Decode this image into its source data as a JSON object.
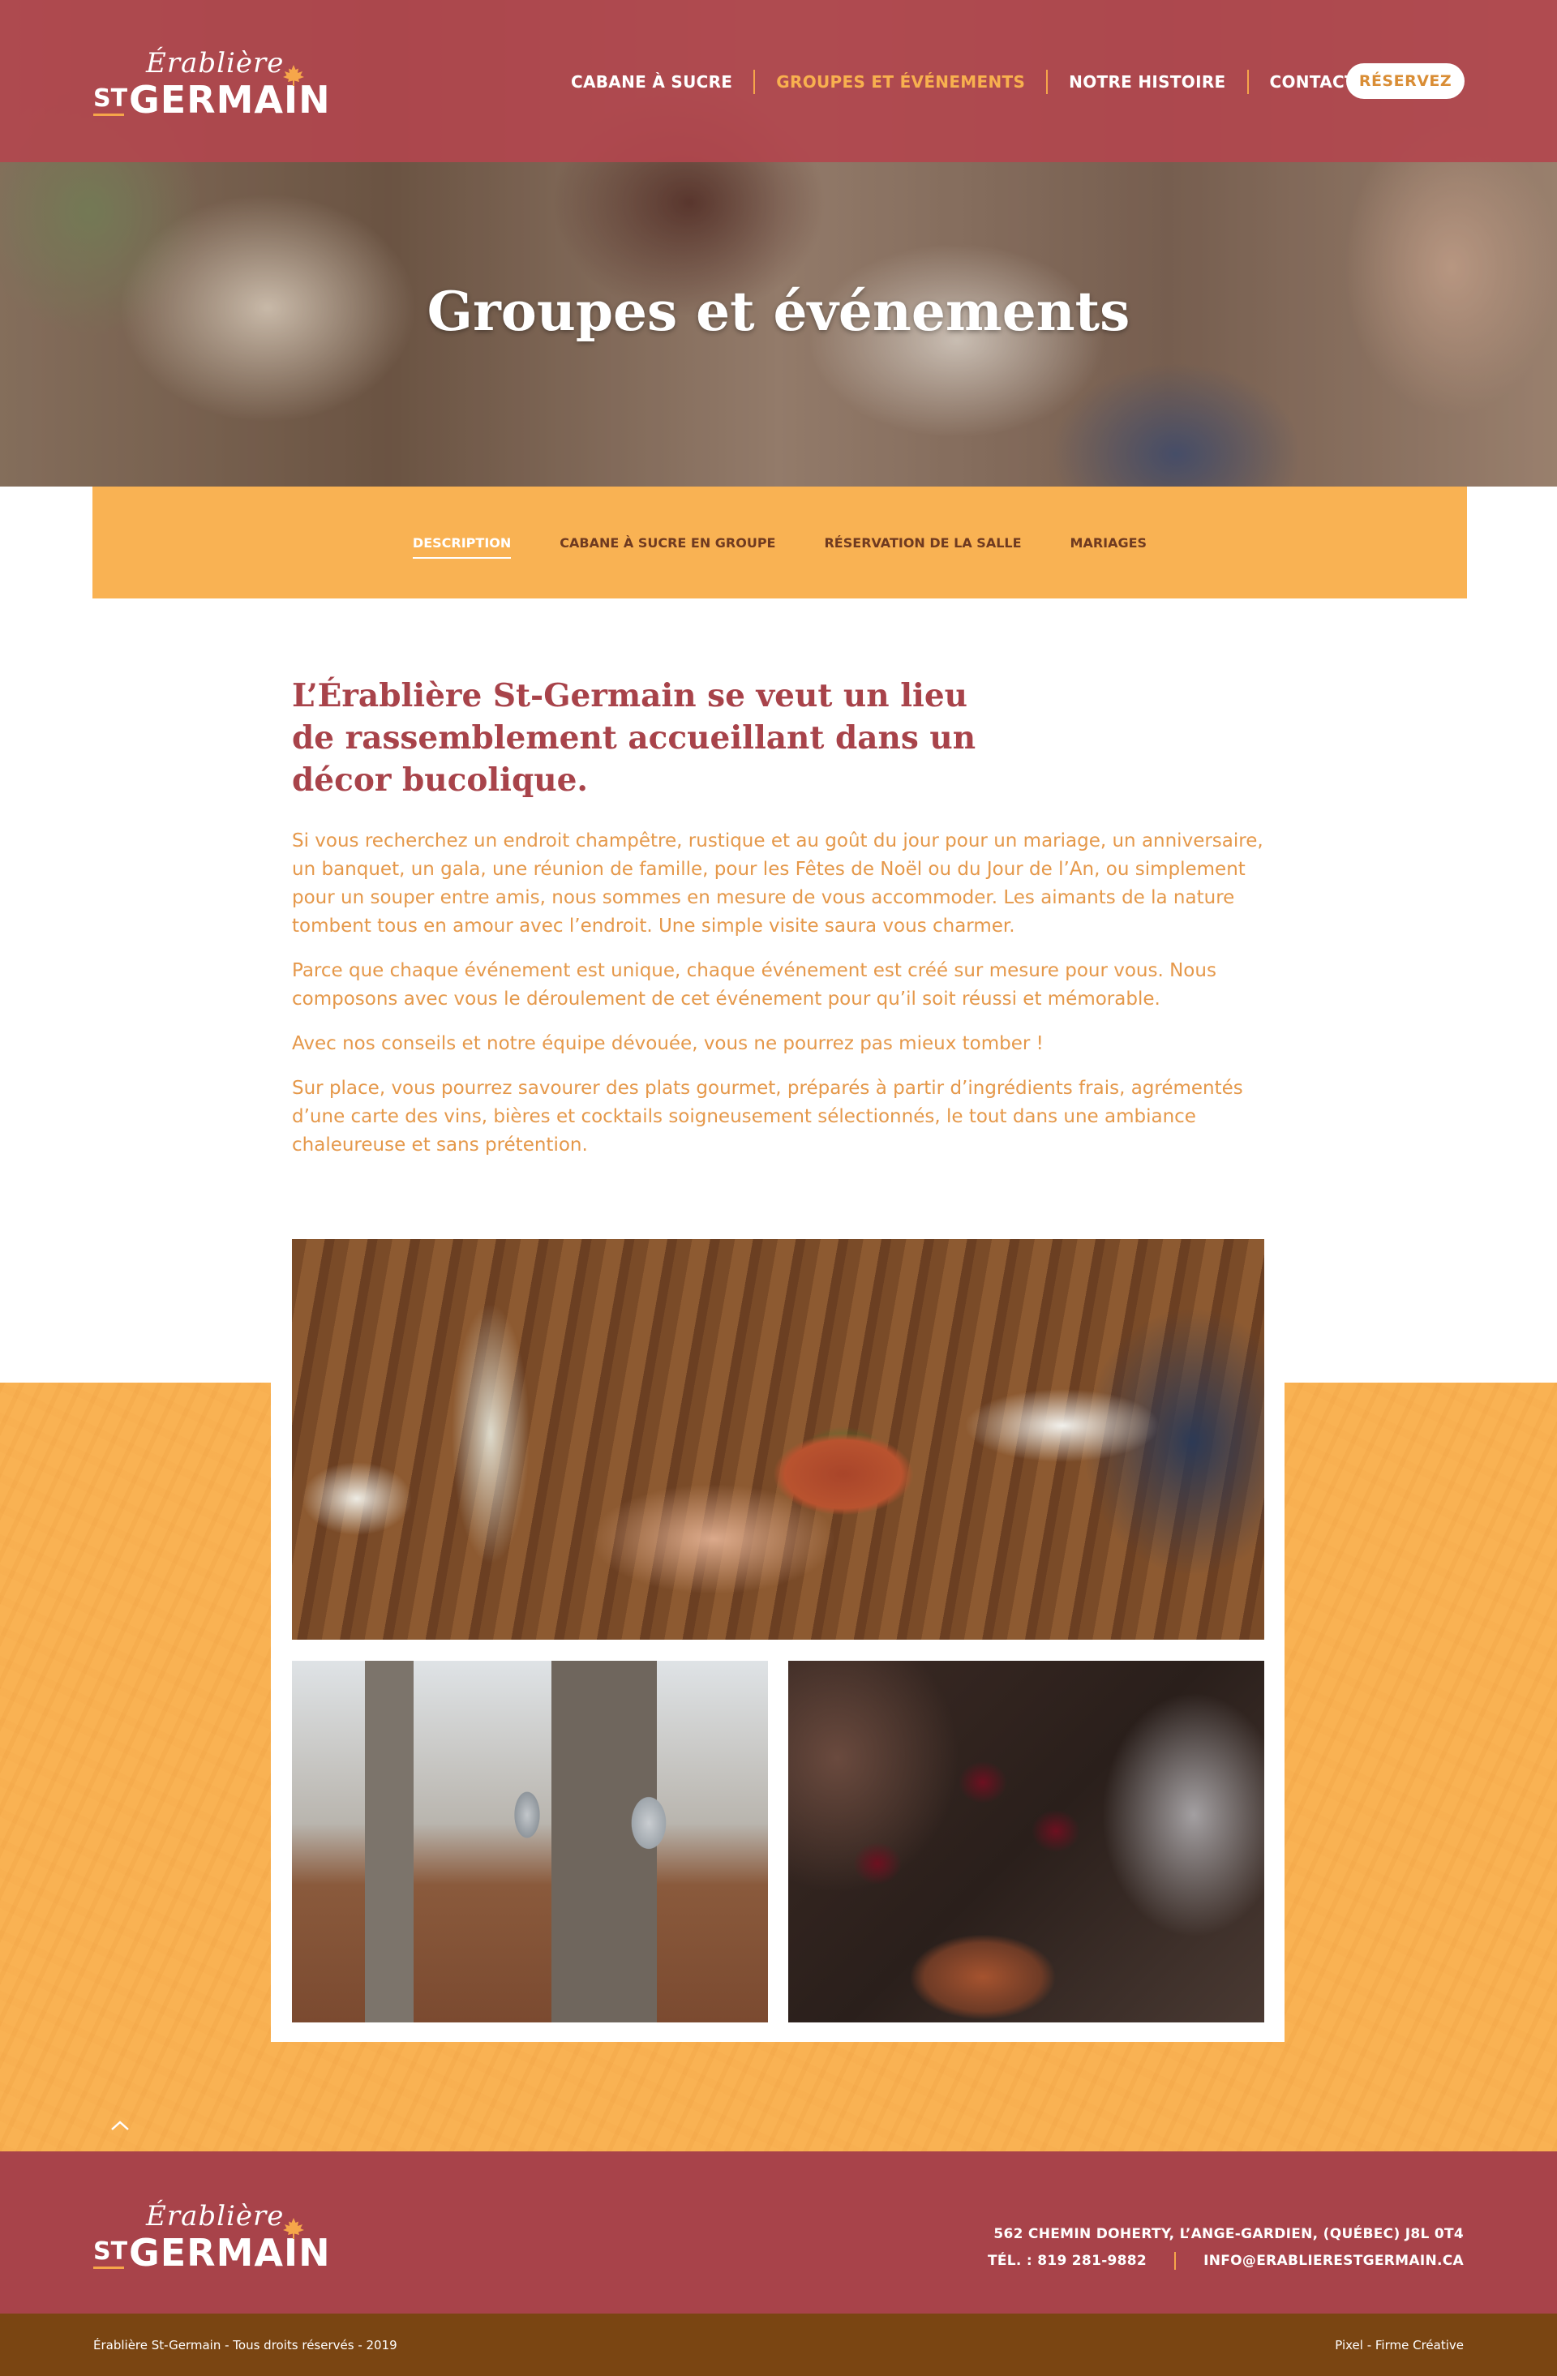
{
  "brand": {
    "script": "Érablière",
    "prefix": "ST",
    "name": "GERMAIN",
    "leaf_color": "#f6a64a"
  },
  "nav": {
    "items": [
      {
        "label": "CABANE À SUCRE",
        "active": false
      },
      {
        "label": "GROUPES ET ÉVÉNEMENTS",
        "active": true
      },
      {
        "label": "NOTRE HISTOIRE",
        "active": false
      },
      {
        "label": "CONTACT",
        "active": false
      }
    ],
    "reserve_label": "RÉSERVEZ"
  },
  "hero": {
    "title": "Groupes et événements"
  },
  "subnav": {
    "items": [
      {
        "label": "DESCRIPTION",
        "active": true
      },
      {
        "label": "CABANE À SUCRE EN GROUPE",
        "active": false
      },
      {
        "label": "RÉSERVATION DE LA SALLE",
        "active": false
      },
      {
        "label": "MARIAGES",
        "active": false
      }
    ]
  },
  "content": {
    "headline": "L’Érablière St-Germain se veut un lieu de rassemblement accueillant dans un décor bucolique.",
    "paragraphs": [
      "Si vous recherchez un endroit champêtre, rustique et au goût du jour pour un mariage, un anniversaire, un banquet, un gala, une réunion de famille, pour les Fêtes de Noël ou du Jour de l’An, ou simplement pour un souper entre amis, nous sommes en mesure de vous accommoder. Les aimants de la nature tombent tous en amour avec l’endroit. Une simple visite saura vous charmer.",
      "Parce que chaque événement est unique, chaque événement est créé sur mesure pour vous. Nous composons avec vous le déroulement de cet événement pour qu’il soit réussi et mémorable.",
      "Avec nos conseils et notre équipe dévouée, vous ne pourrez pas mieux tomber !",
      "Sur place, vous pourrez savourer des plats gourmet, préparés à partir d’ingrédients frais, agrémentés d’une carte des vins, bières et cocktails soigneusement sélectionnés, le tout dans une ambiance chaleureuse et sans prétention."
    ]
  },
  "footer": {
    "address": "562 CHEMIN DOHERTY, L’ANGE-GARDIEN, (QUÉBEC)  J8L 0T4",
    "phone": "TÉL. : 819 281-9882",
    "email": "INFO@ERABLIERESTGERMAIN.CA",
    "copyright": "Érablière St-Germain - Tous droits réservés - 2019",
    "credit": "Pixel - Firme Créative"
  },
  "colors": {
    "topbar": "#b2464e",
    "accent": "#f9b253",
    "headline": "#a8434a",
    "body_text": "#e5984a",
    "footer": "#a8434a",
    "bottombar": "#7a4512"
  }
}
